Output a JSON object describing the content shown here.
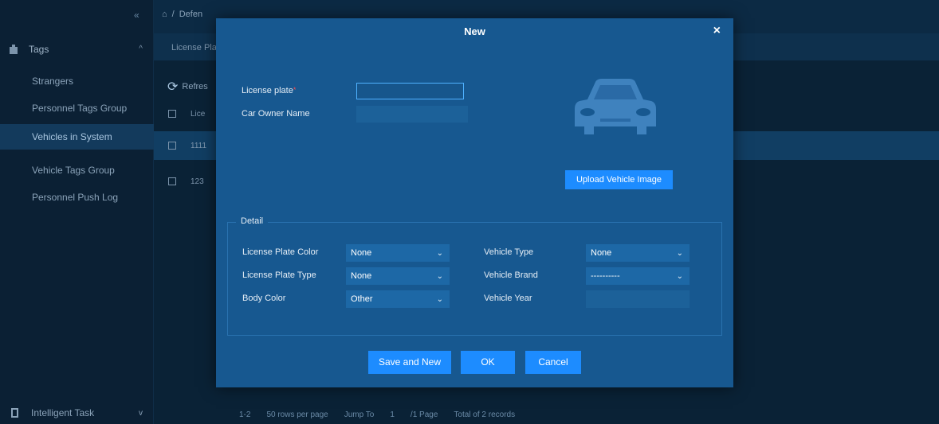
{
  "sidebar": {
    "collapse_glyph": "«",
    "group_label": "Tags",
    "items": [
      {
        "label": "Strangers"
      },
      {
        "label": "Personnel Tags Group"
      },
      {
        "label": "Vehicles in System"
      },
      {
        "label": "Vehicle Tags Group"
      },
      {
        "label": "Personnel Push Log"
      }
    ],
    "bottom_label": "Intelligent Task"
  },
  "breadcrumb": {
    "home_glyph": "⌂",
    "sep": "/",
    "first": "Defen"
  },
  "subtab": {
    "label": "License Pla"
  },
  "toolbar": {
    "refresh_label": "Refres"
  },
  "table": {
    "header": "Lice",
    "rows": [
      {
        "value": "1111"
      },
      {
        "value": "123"
      }
    ]
  },
  "pager": {
    "range": "1-2",
    "rows_per_page": "50 rows per page",
    "jump_label": "Jump To",
    "jump_value": "1",
    "pages": "/1 Page",
    "total": "Total of 2 records"
  },
  "modal": {
    "title": "New",
    "close_glyph": "×",
    "license_plate_label": "License plate",
    "required_mark": "*",
    "license_plate_value": "",
    "car_owner_label": "Car Owner Name",
    "car_owner_value": "",
    "upload_label": "Upload Vehicle Image",
    "detail_legend": "Detail",
    "fields": {
      "plate_color_label": "License Plate Color",
      "plate_color_value": "None",
      "plate_type_label": "License Plate Type",
      "plate_type_value": "None",
      "body_color_label": "Body Color",
      "body_color_value": "Other",
      "vehicle_type_label": "Vehicle Type",
      "vehicle_type_value": "None",
      "vehicle_brand_label": "Vehicle Brand",
      "vehicle_brand_value": "----------",
      "vehicle_year_label": "Vehicle Year",
      "vehicle_year_value": ""
    },
    "buttons": {
      "save_new": "Save and New",
      "ok": "OK",
      "cancel": "Cancel"
    }
  },
  "colors": {
    "accent": "#1d8cff",
    "modal_bg": "#175890",
    "page_bg": "#0a2236",
    "required": "#ff4d4d"
  }
}
